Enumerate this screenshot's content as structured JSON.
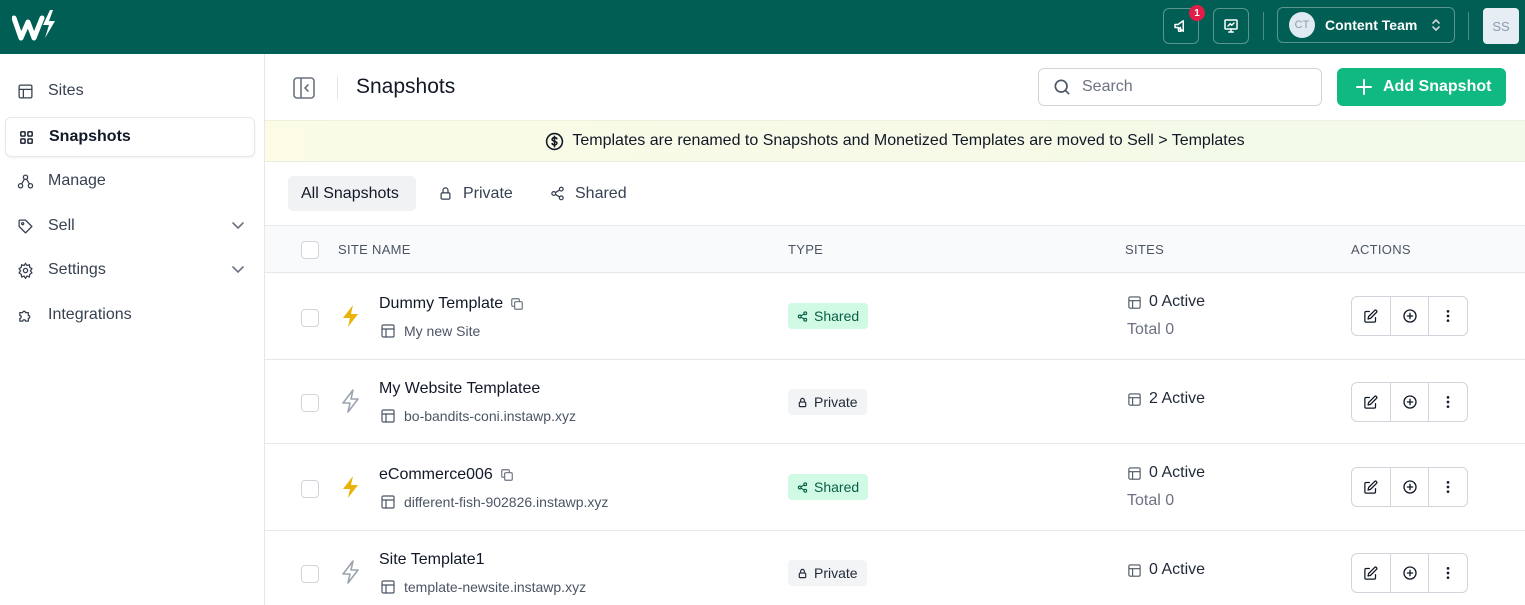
{
  "topbar": {
    "notification_count": "1",
    "team": {
      "initials": "CT",
      "name": "Content Team"
    },
    "user_initials": "SS"
  },
  "sidebar": {
    "items": [
      {
        "label": "Sites",
        "icon": "layout-icon"
      },
      {
        "label": "Snapshots",
        "icon": "grid-icon",
        "active": true
      },
      {
        "label": "Manage",
        "icon": "sitemap-icon"
      },
      {
        "label": "Sell",
        "icon": "tag-icon",
        "expandable": true
      },
      {
        "label": "Settings",
        "icon": "gear-icon",
        "expandable": true
      },
      {
        "label": "Integrations",
        "icon": "puzzle-icon"
      }
    ]
  },
  "header": {
    "title": "Snapshots",
    "search_placeholder": "Search",
    "add_button": "Add Snapshot"
  },
  "banner": {
    "text": "Templates are renamed to Snapshots and Monetized Templates are moved to Sell > Templates"
  },
  "tabs": [
    {
      "label": "All Snapshots",
      "active": true
    },
    {
      "label": "Private",
      "icon": "lock-icon"
    },
    {
      "label": "Shared",
      "icon": "share-icon"
    }
  ],
  "table": {
    "columns": [
      "SITE NAME",
      "TYPE",
      "SITES",
      "ACTIONS"
    ],
    "rows": [
      {
        "name": "Dummy Template",
        "url": "My new Site",
        "type": "Shared",
        "active": "0 Active",
        "total": "Total 0",
        "bolt_color": "#eab308",
        "copy_icon": true
      },
      {
        "name": "My Website Templatee",
        "url": "bo-bandits-coni.instawp.xyz",
        "type": "Private",
        "active": "2 Active",
        "total": "",
        "bolt_color": "#9ca3af",
        "copy_icon": false
      },
      {
        "name": "eCommerce006",
        "url": "different-fish-902826.instawp.xyz",
        "type": "Shared",
        "active": "0 Active",
        "total": "Total 0",
        "bolt_color": "#eab308",
        "copy_icon": true
      },
      {
        "name": "Site Template1",
        "url": "template-newsite.instawp.xyz",
        "type": "Private",
        "active": "0 Active",
        "total": "",
        "bolt_color": "#9ca3af",
        "copy_icon": false
      }
    ]
  },
  "colors": {
    "topbar": "#005e54",
    "primary_button": "#10b981",
    "shared_badge_bg": "#d1fae5",
    "shared_badge_text": "#065f46",
    "notification_badge": "#e11d48"
  }
}
